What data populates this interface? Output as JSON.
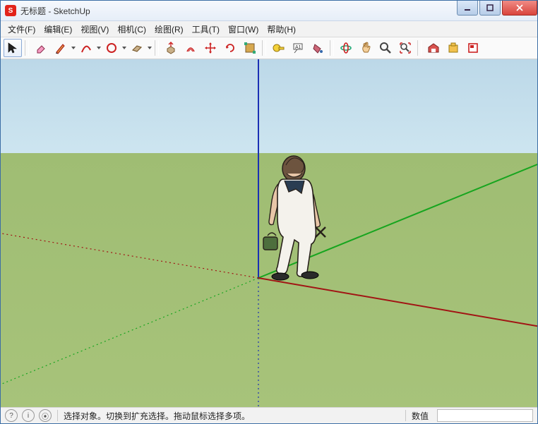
{
  "window": {
    "app_icon_letter": "S",
    "title": "无标题 - SketchUp"
  },
  "menus": [
    {
      "label": "文件(F)"
    },
    {
      "label": "编辑(E)"
    },
    {
      "label": "视图(V)"
    },
    {
      "label": "相机(C)"
    },
    {
      "label": "绘图(R)"
    },
    {
      "label": "工具(T)"
    },
    {
      "label": "窗口(W)"
    },
    {
      "label": "帮助(H)"
    }
  ],
  "toolbar": [
    {
      "name": "select-tool",
      "active": true,
      "dd": false
    },
    {
      "name": "sep"
    },
    {
      "name": "eraser-tool",
      "dd": false
    },
    {
      "name": "pencil-tool",
      "dd": true
    },
    {
      "name": "arc-tool",
      "dd": true
    },
    {
      "name": "shape-tool",
      "dd": true
    },
    {
      "name": "rectangle-tool",
      "dd": true
    },
    {
      "name": "sep"
    },
    {
      "name": "pushpull-tool",
      "dd": false
    },
    {
      "name": "offset-tool",
      "dd": false
    },
    {
      "name": "move-tool",
      "dd": false
    },
    {
      "name": "rotate-tool",
      "dd": false
    },
    {
      "name": "scale-tool",
      "dd": false
    },
    {
      "name": "sep"
    },
    {
      "name": "tape-tool",
      "dd": false
    },
    {
      "name": "text-tool",
      "dd": false
    },
    {
      "name": "paint-tool",
      "dd": false
    },
    {
      "name": "sep"
    },
    {
      "name": "orbit-tool",
      "dd": false
    },
    {
      "name": "pan-tool",
      "dd": false
    },
    {
      "name": "zoom-tool",
      "dd": false
    },
    {
      "name": "zoom-extents-tool",
      "dd": false
    },
    {
      "name": "sep"
    },
    {
      "name": "warehouse-tool",
      "dd": false
    },
    {
      "name": "extension-tool",
      "dd": false
    },
    {
      "name": "layout-tool",
      "dd": false
    }
  ],
  "status": {
    "msg": "选择对象。切换到扩充选择。拖动鼠标选择多项。",
    "value_label": "数值",
    "value": ""
  },
  "icons": {
    "question": "?",
    "info": "i",
    "user": "⦿"
  },
  "colors": {
    "axis_blue": "#1a2fb4",
    "axis_green": "#17a51f",
    "axis_red": "#a11414",
    "sky": "#bcd8e8",
    "ground": "#a6c279"
  }
}
